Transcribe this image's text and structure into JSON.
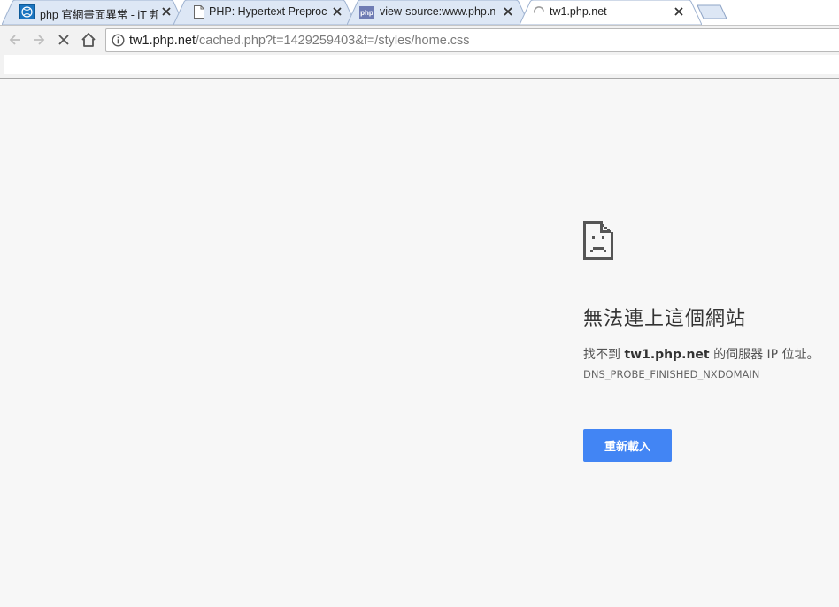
{
  "tabs": [
    {
      "title": "php 官網畫面異常 - iT 邦",
      "icon": "ithome-globe-icon"
    },
    {
      "title": "PHP: Hypertext Preproc",
      "icon": "page-icon"
    },
    {
      "title": "view-source:www.php.n",
      "icon": "php-icon",
      "icon_text": "php"
    },
    {
      "title": "tw1.php.net",
      "icon": "loading-spinner-icon",
      "active": true
    }
  ],
  "toolbar": {
    "url_host": "tw1.php.net",
    "url_path": "/cached.php?t=1429259403&f=/styles/home.css"
  },
  "error_page": {
    "title": "無法連上這個網站",
    "desc_prefix": "找不到 ",
    "desc_host": "tw1.php.net",
    "desc_suffix": " 的伺服器 IP 位址。",
    "error_code": "DNS_PROBE_FINISHED_NXDOMAIN",
    "reload_label": "重新載入",
    "icon": "sad-page-icon"
  },
  "colors": {
    "accent_button": "#4285f4",
    "page_background": "#f7f7f7",
    "inactive_tab": "#dce6f4",
    "active_tab": "#ffffff"
  }
}
